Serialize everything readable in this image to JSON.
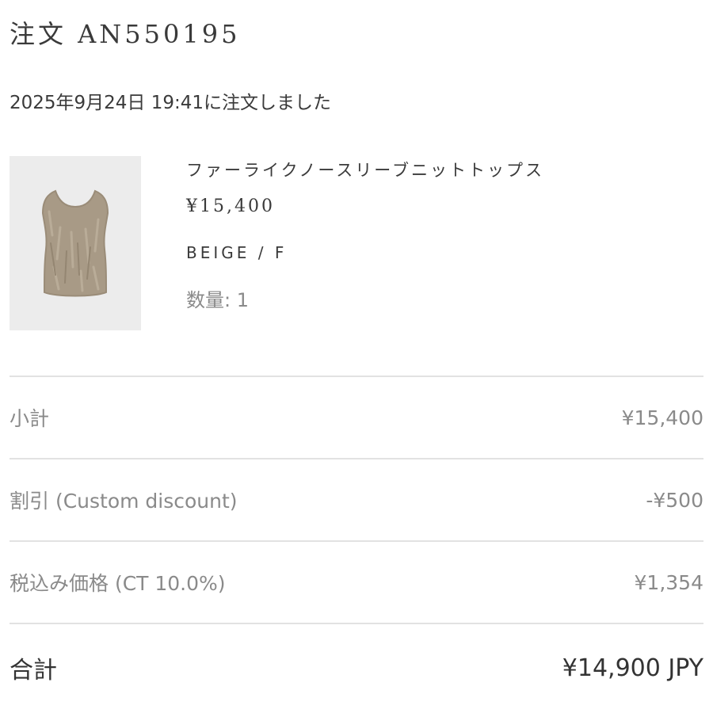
{
  "order": {
    "title": "注文 AN550195",
    "date_text": "2025年9月24日 19:41に注文しました"
  },
  "product": {
    "image_icon": "knit-top-thumbnail",
    "name": "ファーライクノースリーブニットトップス",
    "price": "¥15,400",
    "variant": "BEIGE / F",
    "quantity_text": "数量: 1"
  },
  "summary": {
    "subtotal": {
      "label": "小計",
      "value": "¥15,400"
    },
    "discount": {
      "label": "割引 (Custom discount)",
      "value": "-¥500"
    },
    "tax": {
      "label": "税込み価格 (CT 10.0%)",
      "value": "¥1,354"
    },
    "total": {
      "label": "合計",
      "value": "¥14,900 JPY"
    }
  },
  "colors": {
    "text": "#333333",
    "muted": "#8a8a8a",
    "divider": "#e2e2e2",
    "image_bg": "#ececec",
    "product_fur": "#a89a86"
  }
}
